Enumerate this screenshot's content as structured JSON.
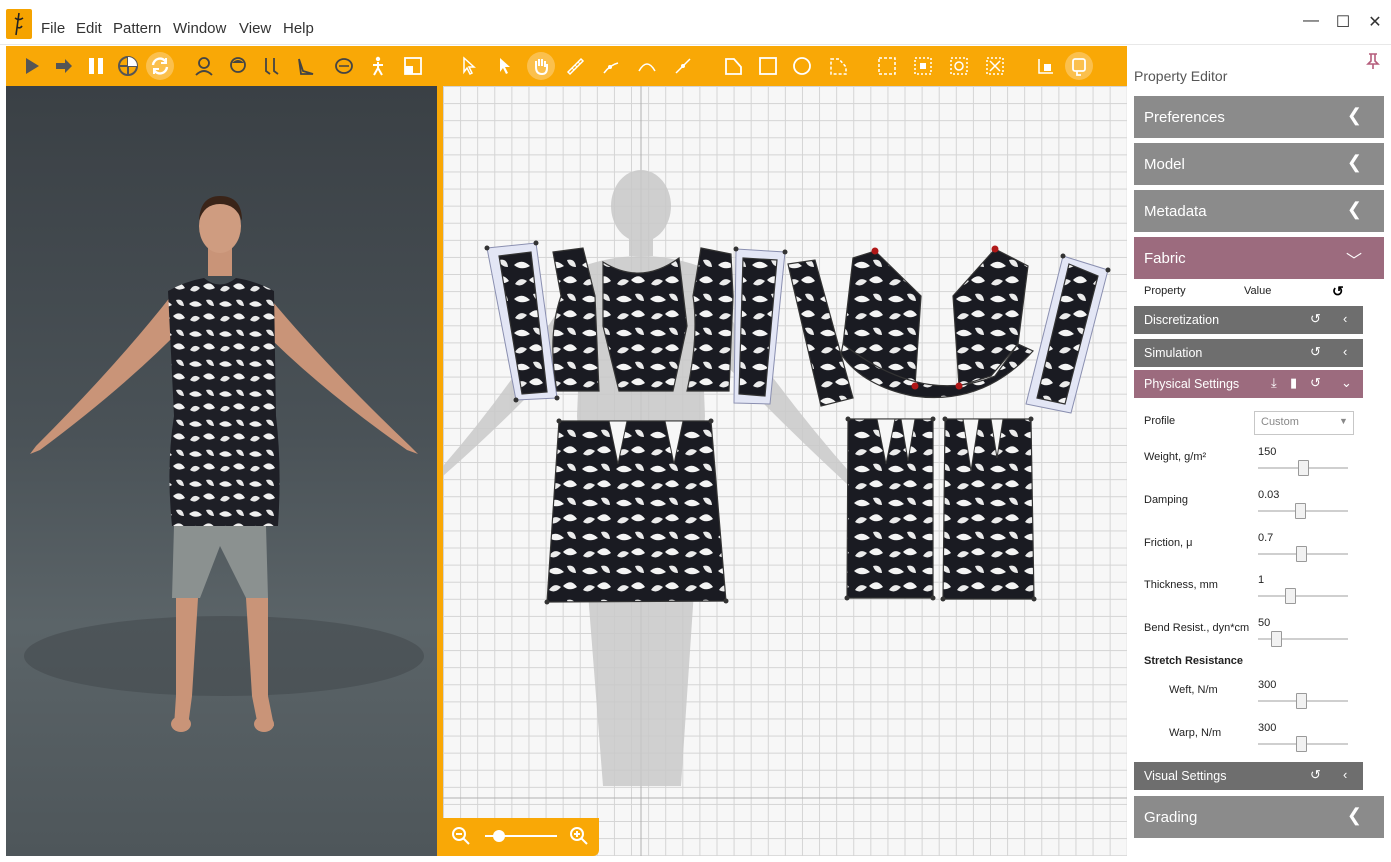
{
  "menu": {
    "items": [
      "File",
      "Edit",
      "Pattern",
      "Window",
      "View",
      "Help"
    ]
  },
  "window_controls": {
    "minimize": "—",
    "maximize": "☐",
    "close": "✕"
  },
  "left_toolbar": {
    "icons": [
      "play-icon",
      "step-forward-icon",
      "pause-icon",
      "reset-view-icon",
      "sync-icon",
      "avatar-head-icon",
      "hair-icon",
      "shoes-icon",
      "heel-icon",
      "measure-tape-icon",
      "pose-icon",
      "layout-icon"
    ]
  },
  "right_toolbar": {
    "icons": [
      "select-arrow-icon",
      "transform-arrow-icon",
      "hand-pan-icon",
      "ruler-icon",
      "point-edit-icon",
      "curve-icon",
      "segment-icon",
      "polygon-icon",
      "rectangle-icon",
      "circle-icon",
      "internal-polygon-icon",
      "internal-rect-icon",
      "dart-icon",
      "grade-icon",
      "notch-icon",
      "symmetry-icon",
      "fold-icon"
    ]
  },
  "property_editor": {
    "title": "Property Editor",
    "sections": {
      "preferences": "Preferences",
      "model": "Model",
      "metadata": "Metadata",
      "fabric": "Fabric",
      "grading": "Grading"
    },
    "fabric": {
      "col_property": "Property",
      "col_value": "Value",
      "discretization": "Discretization",
      "simulation": "Simulation",
      "physical_settings": "Physical Settings",
      "visual_settings": "Visual Settings",
      "profile_label": "Profile",
      "profile_value": "Custom",
      "weight_label": "Weight, g/m²",
      "weight_value": "150",
      "damping_label": "Damping",
      "damping_value": "0.03",
      "friction_label": "Friction, μ",
      "friction_value": "0.7",
      "thickness_label": "Thickness, mm",
      "thickness_value": "1",
      "bend_label": "Bend Resist., dyn*cm",
      "bend_value": "50",
      "stretch_heading": "Stretch Resistance",
      "weft_label": "Weft, N/m",
      "weft_value": "300",
      "warp_label": "Warp, N/m",
      "warp_value": "300"
    },
    "slider_levels": {
      "weight": 0.5,
      "damping": 0.47,
      "friction": 0.48,
      "thickness": 0.35,
      "bend": 0.2,
      "weft": 0.48,
      "warp": 0.48
    }
  },
  "colors": {
    "accent": "#f9a806",
    "header_gray": "#8b8b8b",
    "fabric_active": "#9c6b7e",
    "sub_header": "#6e6e6e"
  }
}
